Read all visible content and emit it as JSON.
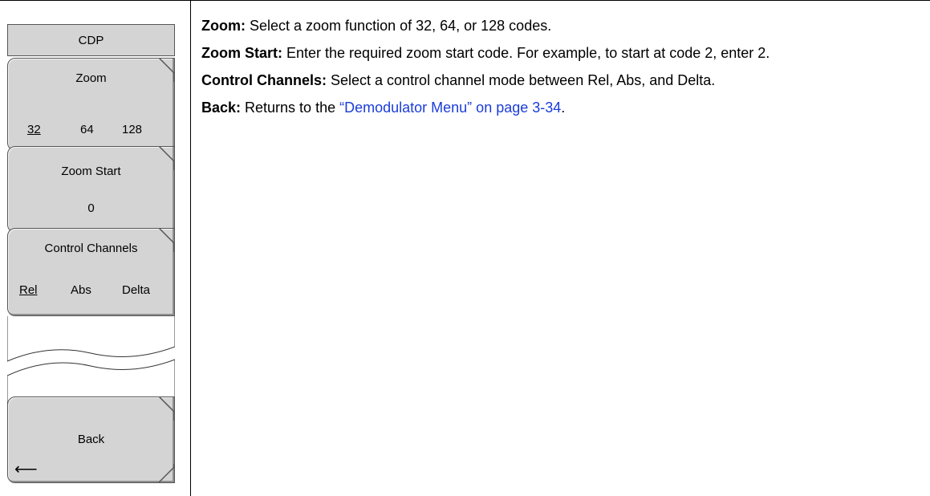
{
  "menu": {
    "title": "CDP",
    "keys": [
      {
        "label": "Zoom",
        "options": [
          "32",
          "64",
          "128"
        ],
        "selected": "32"
      },
      {
        "label": "Zoom Start",
        "value": "0"
      },
      {
        "label": "Control Channels",
        "options": [
          "Rel",
          "Abs",
          "Delta"
        ],
        "selected": "Rel"
      },
      {
        "label": "Back",
        "icon": "left-arrow-icon"
      }
    ]
  },
  "descriptions": [
    {
      "term": "Zoom:",
      "text": " Select a zoom function of 32, 64, or 128 codes."
    },
    {
      "term": "Zoom Start:",
      "text": " Enter the required zoom start code. For example, to start at code 2, enter 2."
    },
    {
      "term": "Control Channels:",
      "text": " Select a control channel mode between Rel, Abs, and Delta."
    },
    {
      "term": "Back:",
      "text": " Returns to the ",
      "link": "“Demodulator Menu” on page 3-34",
      "after": "."
    }
  ],
  "colors": {
    "link": "#1a3cd8",
    "key_fill": "#d4d4d4"
  }
}
